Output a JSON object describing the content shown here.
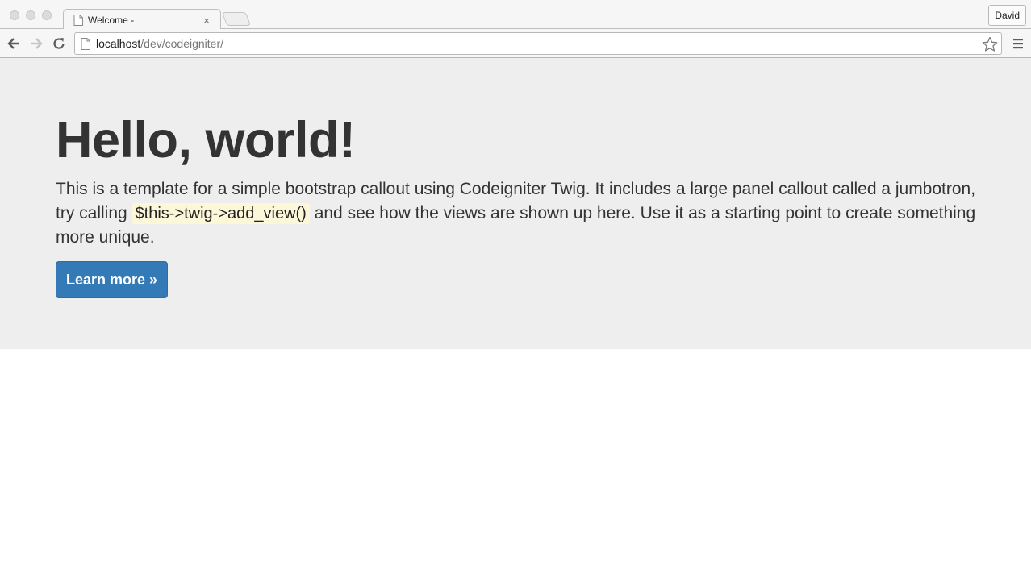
{
  "browser": {
    "tab_title": "Welcome -",
    "tab_close": "×",
    "profile_name": "David",
    "url_host": "localhost",
    "url_path": "/dev/codeigniter/"
  },
  "page": {
    "heading": "Hello, world!",
    "text_before": "This is a template for a simple bootstrap callout using Codeigniter Twig. It includes a large panel callout called a jumbotron, try calling ",
    "code": "$this->twig->add_view()",
    "text_after": " and see how the views are shown up here. Use it as a starting point to create something more unique.",
    "button_label": "Learn more »"
  },
  "colors": {
    "jumbotron_bg": "#eeeeee",
    "primary_button": "#337ab7",
    "code_bg": "#fdf7d9"
  }
}
